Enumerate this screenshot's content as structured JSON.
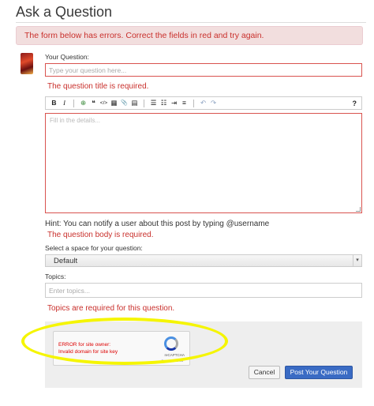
{
  "page": {
    "title": "Ask a Question"
  },
  "alert": {
    "message": "The form below has errors. Correct the fields in red and try again."
  },
  "question": {
    "label": "Your Question:",
    "placeholder": "Type your question here...",
    "error": "The question title is required."
  },
  "editor": {
    "toolbar": {
      "bold": "B",
      "italic": "I",
      "link": "⊕",
      "quote": "❝",
      "code": "</>",
      "image": "▦",
      "attach": "📎",
      "align": "▤",
      "ordered_list": "☰",
      "bullet_list": "☷",
      "indent": "⇥",
      "heading": "≡",
      "undo": "↶",
      "redo": "↷",
      "help": "?"
    },
    "placeholder": "Fill in the details...",
    "hint": "Hint: You can notify a user about this post by typing @username",
    "error": "The question body is required."
  },
  "space": {
    "label": "Select a space for your question:",
    "selected": "Default"
  },
  "topics": {
    "label": "Topics:",
    "placeholder": "Enter topics...",
    "error": "Topics are required for this question."
  },
  "captcha": {
    "error_line1": "ERROR for site owner:",
    "error_line2": "Invalid domain for site key",
    "brand": "reCAPTCHA",
    "links": "Privacy - Terms"
  },
  "buttons": {
    "cancel": "Cancel",
    "post": "Post Your Question"
  },
  "colors": {
    "error": "#c9302c",
    "primary": "#3a6bc4",
    "highlight": "#f5f500"
  }
}
